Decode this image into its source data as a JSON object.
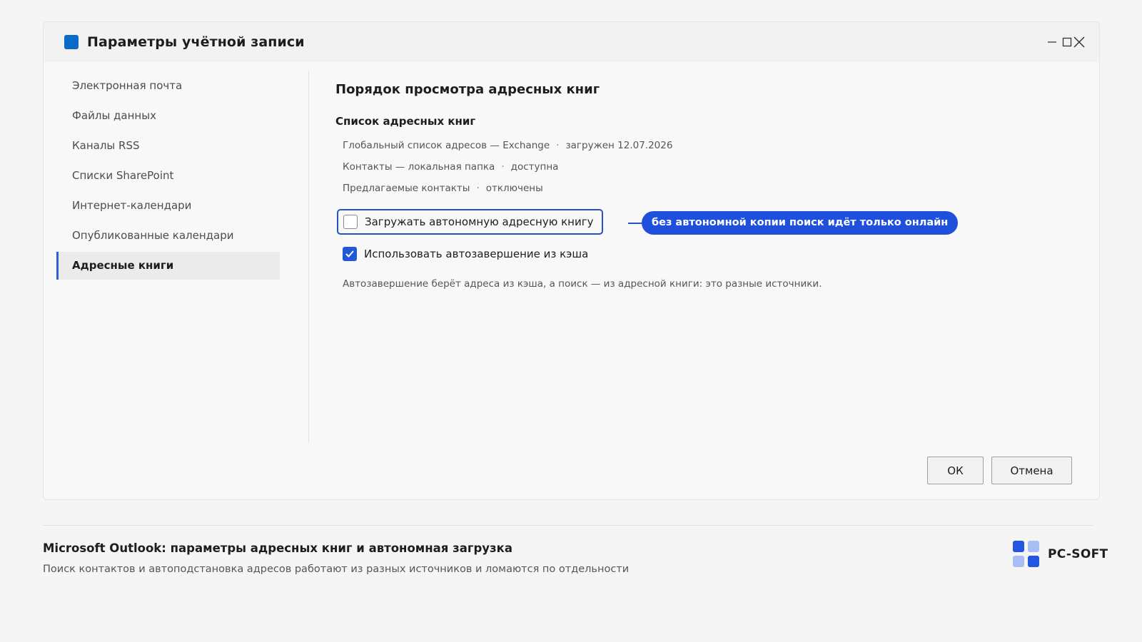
{
  "window": {
    "title": "Параметры учётной записи",
    "accent_color": "#0a6ac7",
    "controls": [
      "minimize-icon",
      "maximize-icon",
      "close-icon"
    ]
  },
  "sidebar": {
    "items": [
      {
        "label": "Электронная почта",
        "active": false
      },
      {
        "label": "Файлы данных",
        "active": false
      },
      {
        "label": "Каналы RSS",
        "active": false
      },
      {
        "label": "Списки SharePoint",
        "active": false
      },
      {
        "label": "Интернет-календари",
        "active": false
      },
      {
        "label": "Опубликованные календари",
        "active": false
      },
      {
        "label": "Адресные книги",
        "active": true
      }
    ]
  },
  "content": {
    "title": "Порядок просмотра адресных книг",
    "list_title": "Список адресных книг",
    "books": [
      {
        "name": "Глобальный список адресов — Exchange",
        "status": "загружен 12.07.2026"
      },
      {
        "name": "Контакты — локальная папка",
        "status": "доступна"
      },
      {
        "name": "Предлагаемые контакты",
        "status": "отключены"
      }
    ],
    "separator": "·",
    "options": {
      "offline": {
        "label": "Загружать автономную адресную книгу",
        "checked": false
      },
      "cache": {
        "label": "Использовать автозавершение из кэша",
        "checked": true
      }
    },
    "callout": "без автономной копии поиск идёт только онлайн",
    "note": "Автозавершение берёт адреса из кэша, а поиск — из адресной книги: это разные источники."
  },
  "buttons": {
    "ok": "ОК",
    "cancel": "Отмена"
  },
  "footer": {
    "title": "Microsoft Outlook: параметры адресных книг и автономная загрузка",
    "subtitle": "Поиск контактов и автоподстановка адресов работают из разных источников и ломаются по отдельности",
    "brand": "PC-SOFT",
    "brand_colors": [
      "#2256e0",
      "#a9bdf5",
      "#a9bdf5",
      "#2256e0"
    ]
  }
}
